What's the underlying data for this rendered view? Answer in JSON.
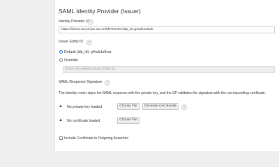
{
  "section": {
    "title": "SAML Identity Provider (Issuer)"
  },
  "idp_url": {
    "label": "Identity Provider URL",
    "help": "?",
    "value": "https://demo-am-prl.pe.na.net/idPServlet?idp_id=g4nds1z9var"
  },
  "issuer_entity": {
    "label": "Issuer Entity ID",
    "help": "?",
    "default_option": "Default (idp_id): g4nds1z9var",
    "override_option": "Override",
    "override_placeholder": "Enter non-default Issuer Entity ID"
  },
  "signature": {
    "label": "SAML Response Signature",
    "help": "?",
    "description": "The identity router signs the SAML response with the private key, and the SP validates the signature with the corresponding certificate.",
    "private_key": {
      "status": "No private key loaded",
      "choose_file": "Choose File",
      "generate": "Generate Cert Bundle",
      "help": "?"
    },
    "certificate": {
      "status": "No certificate loaded",
      "choose_file": "Choose File"
    }
  },
  "include_cert": {
    "label": "Include Certificate in Outgoing Assertion"
  }
}
